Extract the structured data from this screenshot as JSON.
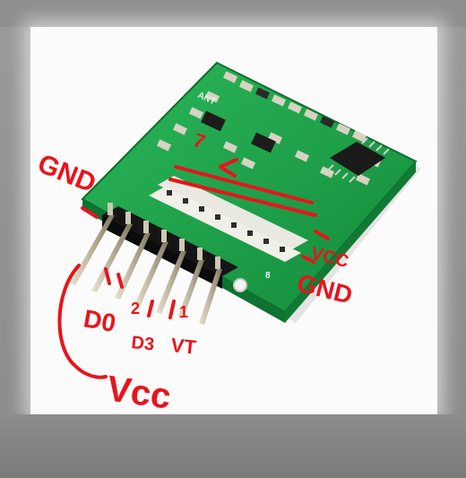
{
  "image": {
    "subject": "photo",
    "background": "#fbfbfb",
    "board_color": "#1fa64a",
    "annotation_color": "#e8141c"
  },
  "silkscreen": {
    "antenna": "ANT",
    "pin_right": "8"
  },
  "annotations": {
    "gnd_left": "GND",
    "vcc_right": "VCC",
    "gnd_right": "GND",
    "vcc_bottom": "Vcc",
    "pin_top": "7",
    "pin_d0": "D0",
    "pin_2": "2",
    "pin_1": "1",
    "pin_d3": "D3",
    "pin_vt": "VT"
  }
}
